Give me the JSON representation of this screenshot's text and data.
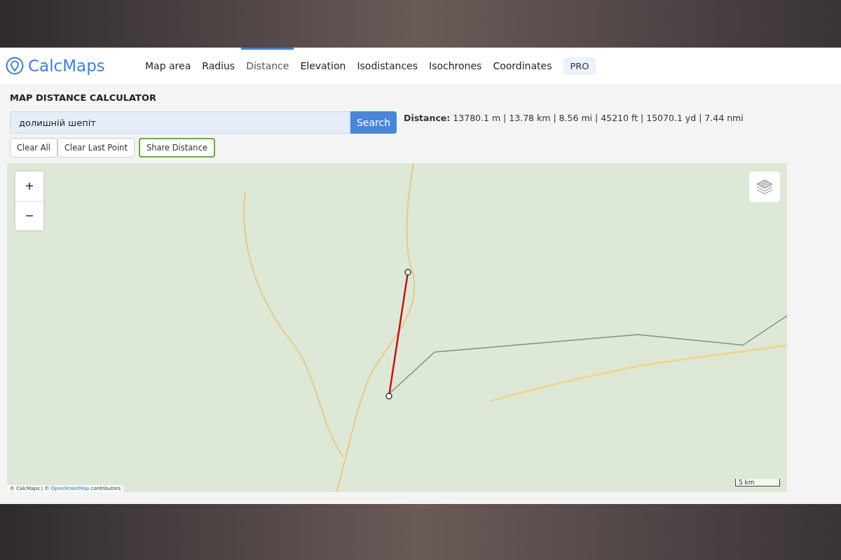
{
  "header": {
    "logo": "CalcMaps",
    "nav": [
      {
        "label": "Map area",
        "selected": false
      },
      {
        "label": "Radius",
        "selected": false
      },
      {
        "label": "Distance",
        "selected": true
      },
      {
        "label": "Elevation",
        "selected": false
      },
      {
        "label": "Isodistances",
        "selected": false
      },
      {
        "label": "Isochrones",
        "selected": false
      },
      {
        "label": "Coordinates",
        "selected": false
      }
    ],
    "pro": "PRO"
  },
  "tool": {
    "title": "MAP DISTANCE CALCULATOR",
    "search": {
      "value": "долишній шепіт",
      "button": "Search"
    },
    "buttons": [
      {
        "label": "Clear All",
        "kind": "plain"
      },
      {
        "label": "Clear Last Point",
        "kind": "plain"
      },
      {
        "label": "Share Distance",
        "kind": "accent"
      }
    ],
    "distance": {
      "label": "Distance:",
      "value": "13780.1 m | 13.78 km | 8.56 mi | 45210 ft | 15070.1 yd | 7.44 nmi"
    }
  },
  "map": {
    "zoom_in": "+",
    "zoom_out": "−",
    "attribution": {
      "prefix": "© CalcMaps | ©",
      "link": "OpenStreetMap",
      "suffix": "contributors"
    },
    "scale": "5 km"
  }
}
